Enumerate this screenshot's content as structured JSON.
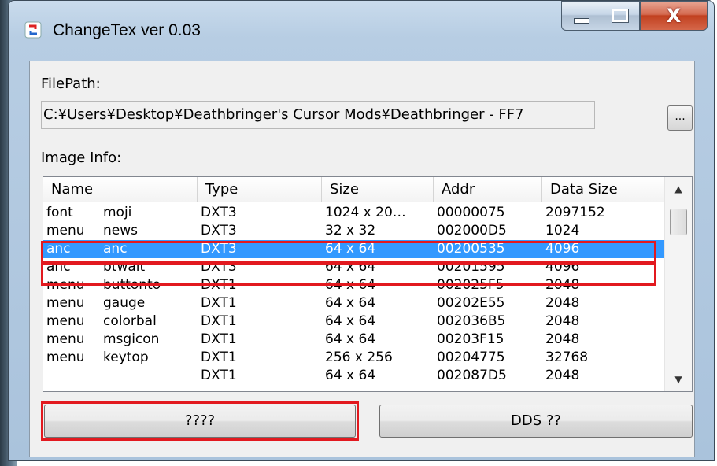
{
  "window": {
    "title": "ChangeTex ver 0.03",
    "close_glyph": "X",
    "icons": [
      "app-icon",
      "minimize-icon",
      "maximize-icon",
      "close-icon"
    ]
  },
  "filepath": {
    "label": "FilePath:",
    "value": "C:¥Users¥Desktop¥Deathbringer's Cursor Mods¥Deathbringer - FF7",
    "browse_label": "..."
  },
  "image_info": {
    "label": "Image Info:",
    "columns": [
      "Name",
      "Type",
      "Size",
      "Addr",
      "Data Size"
    ],
    "rows": [
      {
        "name_a": "font",
        "name_b": "moji",
        "type": "DXT3",
        "size": "1024 x 20…",
        "addr": "00000075",
        "data_size": "2097152"
      },
      {
        "name_a": "menu",
        "name_b": "news",
        "type": "DXT3",
        "size": "32 x 32",
        "addr": "002000D5",
        "data_size": "1024"
      },
      {
        "name_a": "anc",
        "name_b": "anc",
        "type": "DXT3",
        "size": "64 x 64",
        "addr": "00200535",
        "data_size": "4096"
      },
      {
        "name_a": "anc",
        "name_b": "btwait",
        "type": "DXT3",
        "size": "64 x 64",
        "addr": "00201595",
        "data_size": "4096"
      },
      {
        "name_a": "menu",
        "name_b": "buttonto",
        "type": "DXT1",
        "size": "64 x 64",
        "addr": "002025F5",
        "data_size": "2048"
      },
      {
        "name_a": "menu",
        "name_b": "gauge",
        "type": "DXT1",
        "size": "64 x 64",
        "addr": "00202E55",
        "data_size": "2048"
      },
      {
        "name_a": "menu",
        "name_b": "colorbal",
        "type": "DXT1",
        "size": "64 x 64",
        "addr": "002036B5",
        "data_size": "2048"
      },
      {
        "name_a": "menu",
        "name_b": "msgicon",
        "type": "DXT1",
        "size": "64 x 64",
        "addr": "00203F15",
        "data_size": "2048"
      },
      {
        "name_a": "menu",
        "name_b": "keytop",
        "type": "DXT1",
        "size": "256 x 256",
        "addr": "00204775",
        "data_size": "32768"
      },
      {
        "name_a": "",
        "name_b": "",
        "type": "DXT1",
        "size": "64 x 64",
        "addr": "002087D5",
        "data_size": "2048"
      }
    ],
    "selected_row": 2
  },
  "buttons": {
    "left_label": "????",
    "right_label": "DDS ??"
  },
  "colors": {
    "selection": "#3399ff",
    "highlight_box": "#e2191f"
  }
}
